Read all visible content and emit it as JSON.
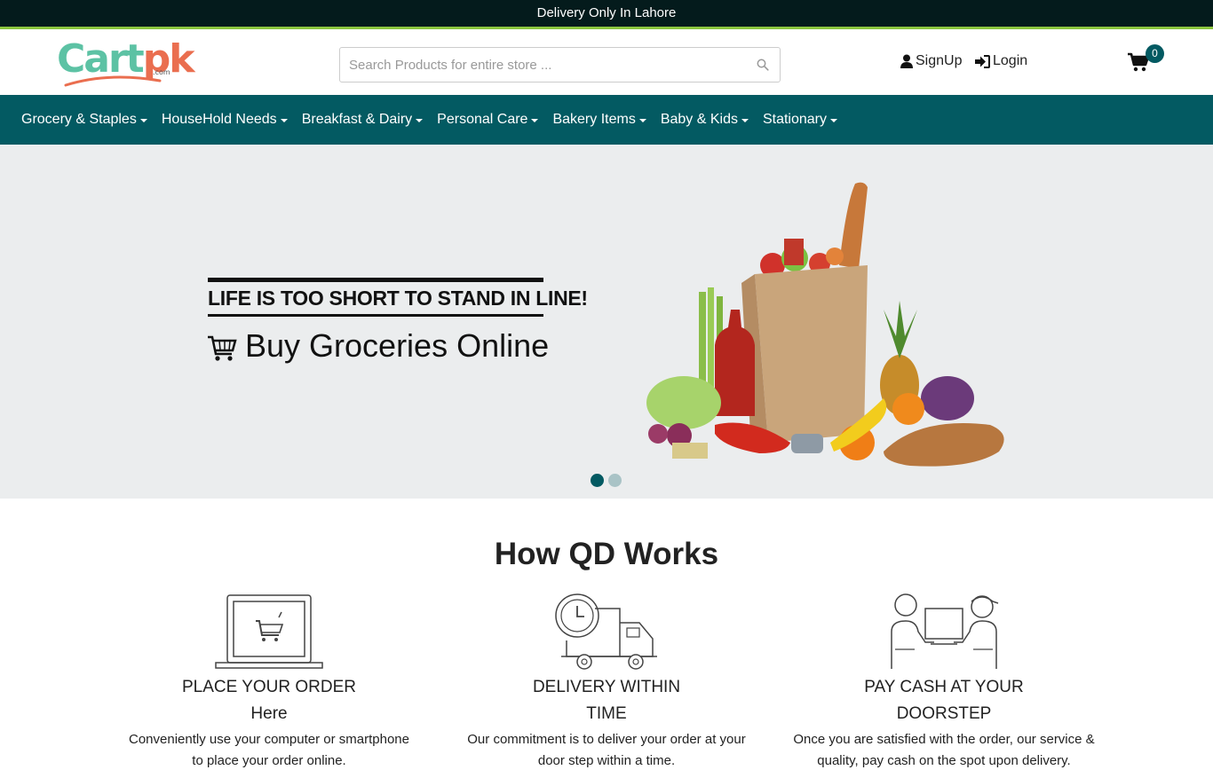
{
  "topbar": {
    "text": "Delivery Only In Lahore"
  },
  "brand": {
    "name_part1": "Cart",
    "name_part2": "pk",
    "suffix": ".com"
  },
  "search": {
    "placeholder": "Search Products for entire store ...",
    "value": ""
  },
  "auth": {
    "signup": "SignUp",
    "login": "Login"
  },
  "cart": {
    "count": "0"
  },
  "nav": {
    "items": [
      {
        "label": "Grocery & Staples"
      },
      {
        "label": "HouseHold Needs"
      },
      {
        "label": "Breakfast & Dairy"
      },
      {
        "label": "Personal Care"
      },
      {
        "label": "Bakery Items"
      },
      {
        "label": "Baby & Kids"
      },
      {
        "label": "Stationary"
      }
    ]
  },
  "hero": {
    "tagline": "LIFE IS TOO SHORT TO STAND IN LINE!",
    "subtitle": "Buy Groceries Online",
    "slide_count": 2,
    "active_slide": 1
  },
  "how": {
    "title": "How QD Works",
    "steps": [
      {
        "icon": "laptop-cart-icon",
        "title_line1": "PLACE YOUR ORDER",
        "title_line2": "Here",
        "desc_line1": "Conveniently use your computer or smartphone",
        "desc_line2": "to place your order online."
      },
      {
        "icon": "delivery-truck-clock-icon",
        "title_line1": "DELIVERY WITHIN",
        "title_line2": "TIME",
        "desc_line1": "Our commitment is to deliver your order at your",
        "desc_line2": "door step within a time."
      },
      {
        "icon": "cash-handover-icon",
        "title_line1": "PAY CASH AT YOUR",
        "title_line2": "DOORSTEP",
        "desc_line1": "Once you are satisfied with the order, our service &",
        "desc_line2": "quality, pay cash on the spot upon delivery."
      }
    ]
  },
  "colors": {
    "topbar": "#041b1c",
    "accent_line": "#8cc63f",
    "nav": "#035a62",
    "logo_green": "#5cc2a4",
    "logo_orange": "#ea6e4f",
    "hero_bg": "#ebedee"
  }
}
